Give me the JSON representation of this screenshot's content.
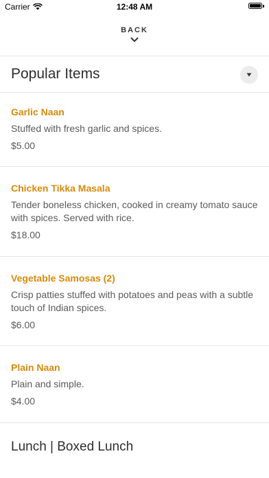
{
  "status_bar": {
    "carrier": "Carrier",
    "time": "12:48 AM"
  },
  "nav": {
    "back_label": "BACK"
  },
  "sections": [
    {
      "title": "Popular Items",
      "items": [
        {
          "name": "Garlic Naan",
          "description": "Stuffed with fresh garlic and spices.",
          "price": "$5.00"
        },
        {
          "name": "Chicken Tikka Masala",
          "description": "Tender boneless chicken, cooked in creamy tomato sauce with spices. Served with rice.",
          "price": "$18.00"
        },
        {
          "name": "Vegetable Samosas (2)",
          "description": "Crisp patties stuffed with potatoes and peas with a subtle touch of Indian spices.",
          "price": "$6.00"
        },
        {
          "name": "Plain Naan",
          "description": "Plain and simple.",
          "price": "$4.00"
        }
      ]
    },
    {
      "title": "Lunch | Boxed Lunch"
    }
  ],
  "colors": {
    "accent": "#d98a0b",
    "text": "#2e2e2e",
    "muted": "#5a5a5a",
    "divider": "#e6e6e6"
  }
}
